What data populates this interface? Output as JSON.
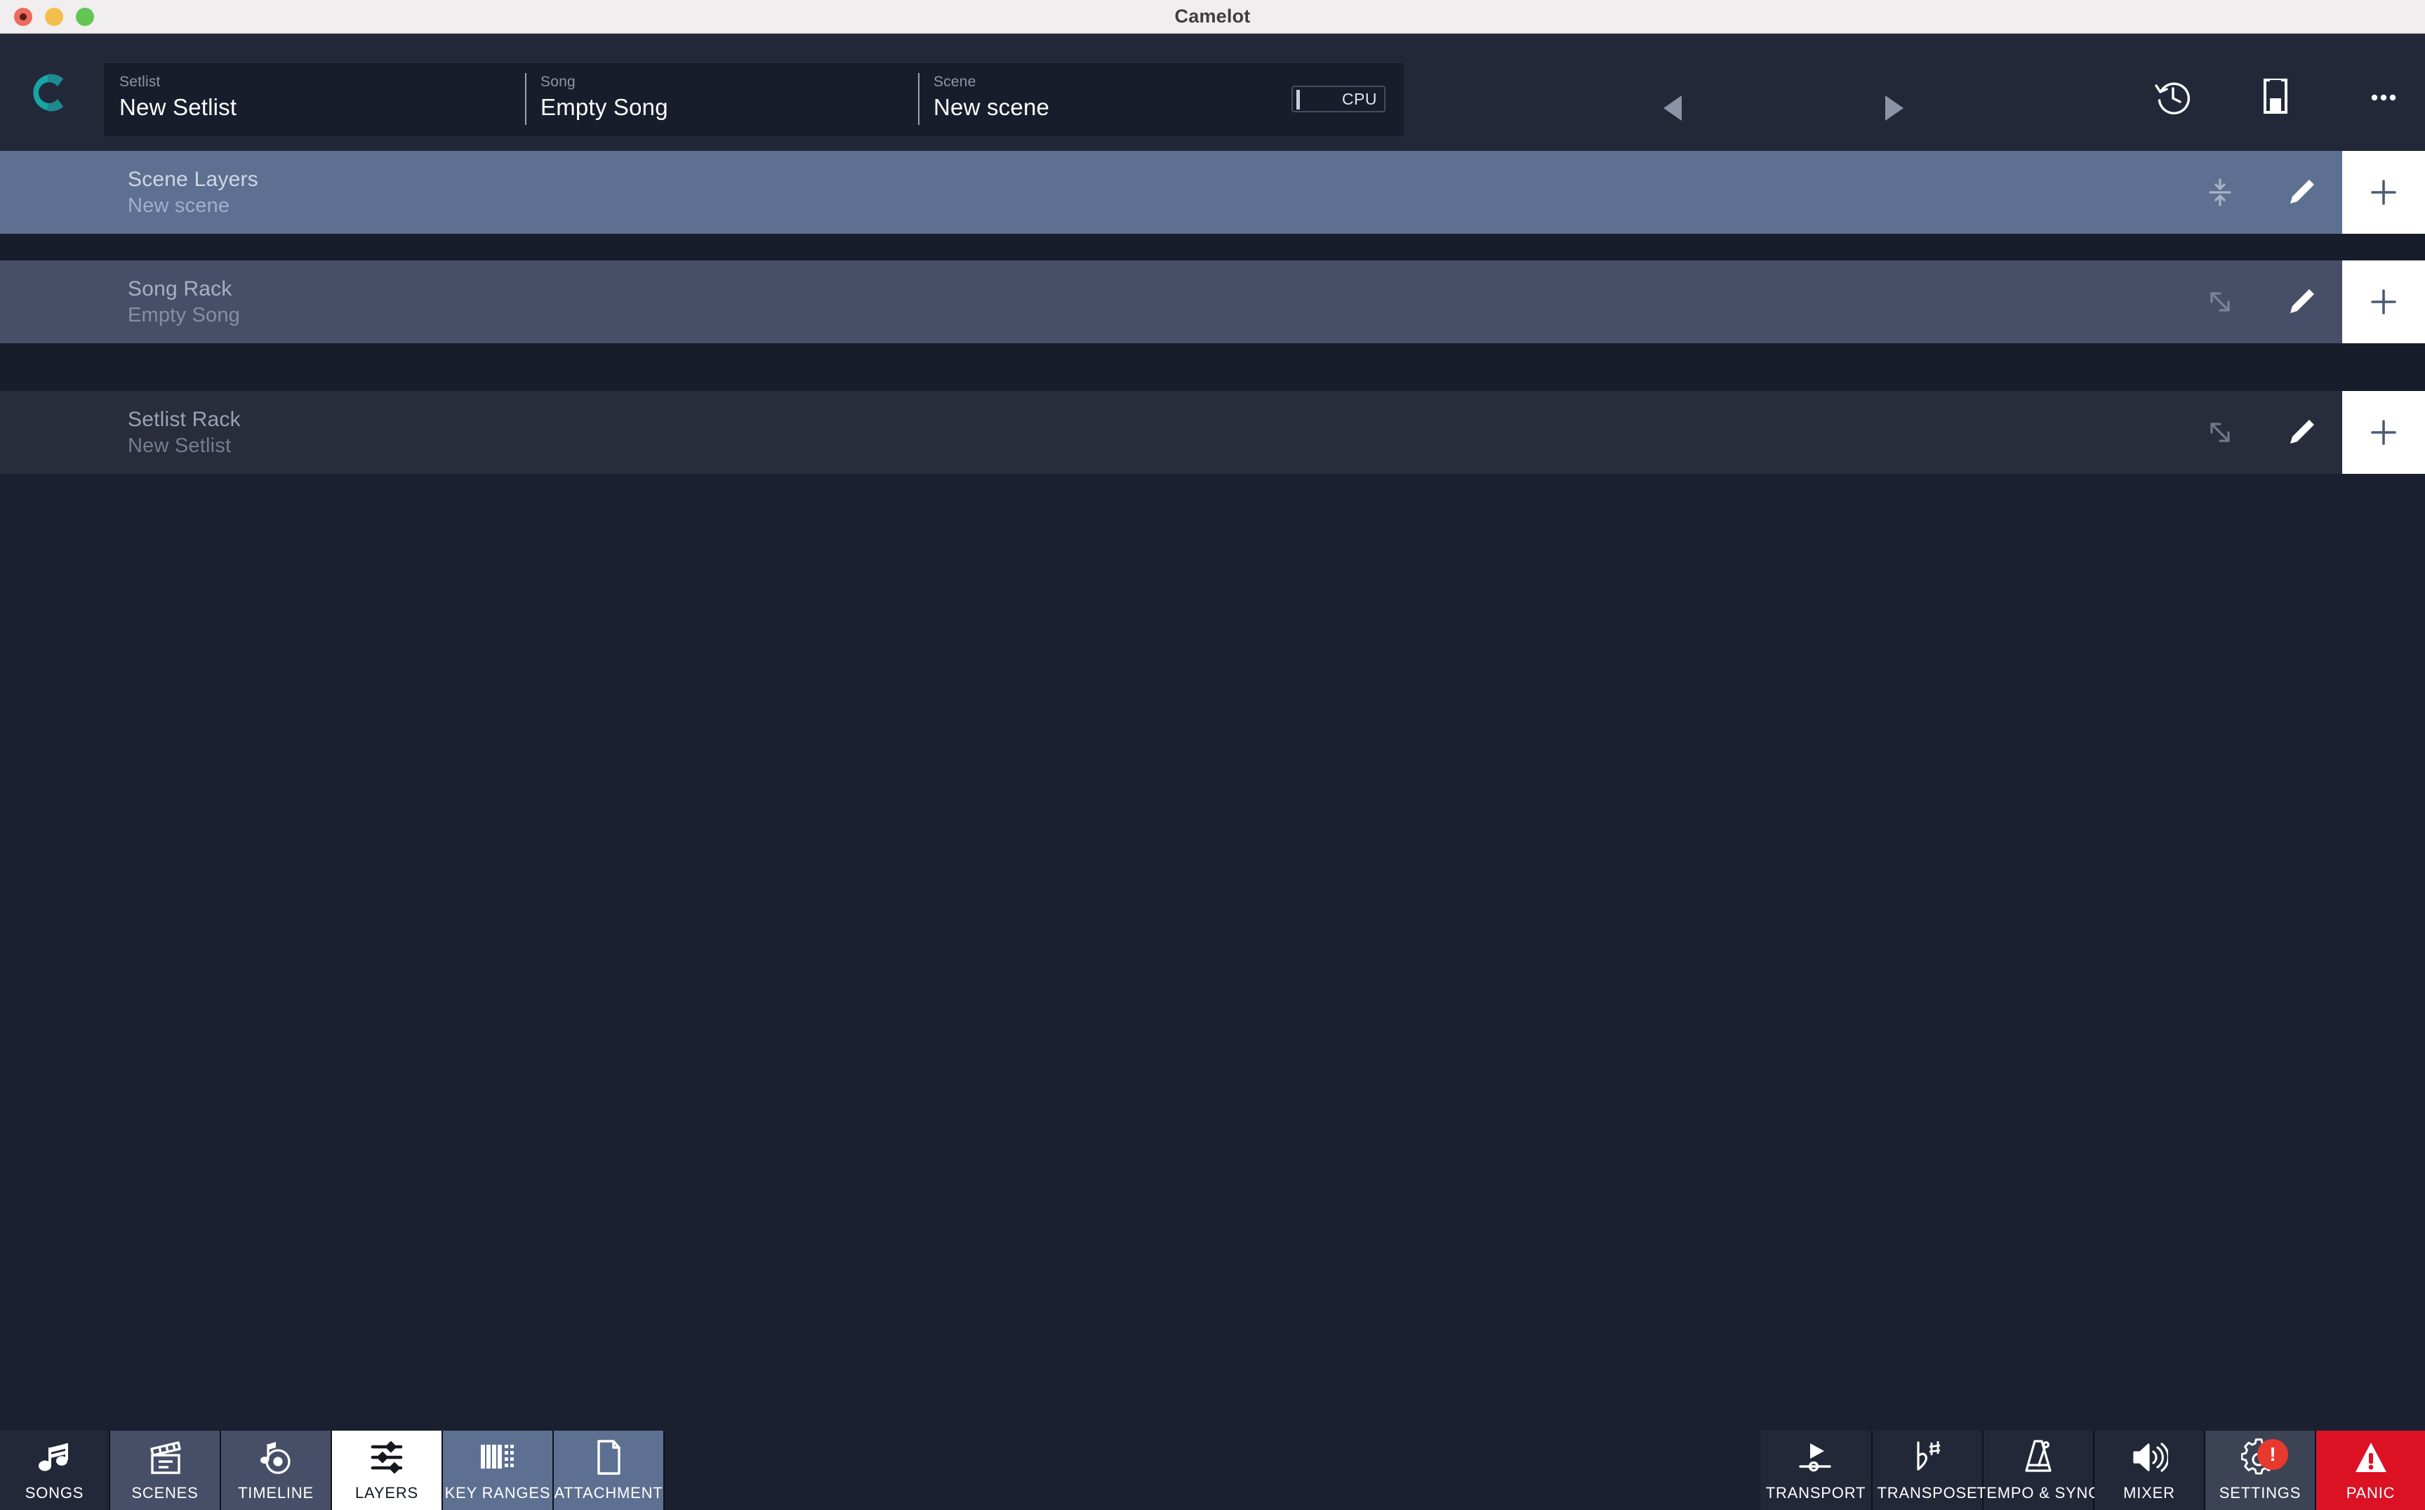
{
  "window": {
    "title": "Camelot",
    "traffic_lights": [
      "close-button",
      "minimize-button",
      "zoom-button"
    ]
  },
  "header": {
    "logo": "camelot-logo",
    "fields": [
      {
        "label": "Setlist",
        "value": "New Setlist"
      },
      {
        "label": "Song",
        "value": "Empty Song"
      },
      {
        "label": "Scene",
        "value": "New scene"
      }
    ],
    "cpu": {
      "label": "CPU",
      "level": 0
    },
    "transport": {
      "prev": "previous-button",
      "next": "next-button"
    },
    "actions": [
      {
        "name": "history-icon",
        "label": "History"
      },
      {
        "name": "save-icon",
        "label": "Save"
      },
      {
        "name": "more-icon",
        "label": "More"
      }
    ]
  },
  "racks": [
    {
      "title": "Scene Layers",
      "subtitle": "New scene",
      "collapse_icon": "collapse-icon",
      "edit_icon": "pencil-icon",
      "add_icon": "plus-icon",
      "color": "#5d7091",
      "selected": true
    },
    {
      "title": "Song Rack",
      "subtitle": "Empty Song",
      "collapse_icon": "expand-icon",
      "edit_icon": "pencil-icon",
      "add_icon": "plus-icon",
      "color": "#474f68",
      "selected": false
    },
    {
      "title": "Setlist Rack",
      "subtitle": "New Setlist",
      "collapse_icon": "expand-icon",
      "edit_icon": "pencil-icon",
      "add_icon": "plus-icon",
      "color": "#282c3b",
      "selected": false
    }
  ],
  "bottom_bar": {
    "left_tabs": [
      {
        "label": "SONGS",
        "icon": "music-note-icon",
        "active": false
      },
      {
        "label": "SCENES",
        "icon": "clapperboard-icon",
        "active": false
      },
      {
        "label": "TIMELINE",
        "icon": "vinyl-note-icon",
        "active": false
      },
      {
        "label": "LAYERS",
        "icon": "sliders-icon",
        "active": true
      },
      {
        "label": "KEY RANGES",
        "icon": "piano-keys-icon",
        "active": false
      },
      {
        "label": "ATTACHMENT",
        "icon": "document-icon",
        "active": false
      }
    ],
    "right_tabs": [
      {
        "label": "TRANSPORT",
        "icon": "play-slider-icon",
        "active": false
      },
      {
        "label": "TRANSPOSE",
        "icon": "flat-sharp-icon",
        "active": false
      },
      {
        "label": "TEMPO & SYNC",
        "icon": "metronome-icon",
        "active": false
      },
      {
        "label": "MIXER",
        "icon": "speaker-icon",
        "active": false
      },
      {
        "label": "SETTINGS",
        "icon": "gear-icon",
        "active": false,
        "badge": "!"
      },
      {
        "label": "PANIC",
        "icon": "warning-icon",
        "active": false
      }
    ]
  },
  "colors": {
    "app_bg": "#1b2030",
    "header_bg": "#232839",
    "infobar_bg": "#181d2b",
    "accent_teal": "#16a6a6",
    "panic_red": "#dc1124",
    "badge_red": "#e8392e"
  }
}
